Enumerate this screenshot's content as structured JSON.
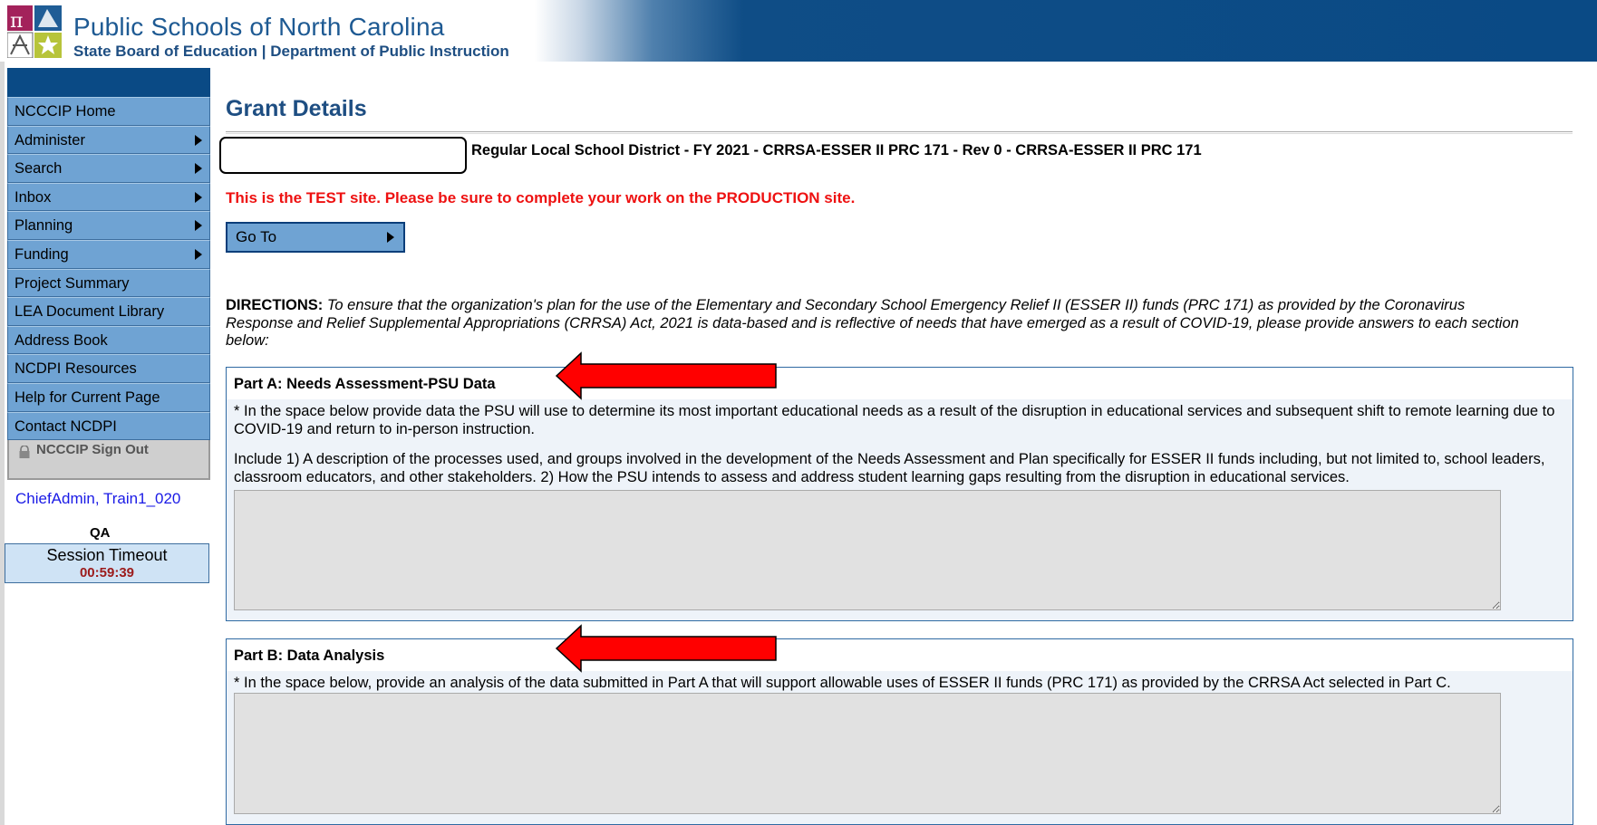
{
  "header": {
    "title": "Public Schools of North Carolina",
    "subtitle": "State Board of Education | Department of Public Instruction"
  },
  "sidebar": {
    "items": [
      {
        "label": "NCCCIP Home",
        "has_submenu": false
      },
      {
        "label": "Administer",
        "has_submenu": true
      },
      {
        "label": "Search",
        "has_submenu": true
      },
      {
        "label": "Inbox",
        "has_submenu": true
      },
      {
        "label": "Planning",
        "has_submenu": true
      },
      {
        "label": "Funding",
        "has_submenu": true
      },
      {
        "label": "Project Summary",
        "has_submenu": false
      },
      {
        "label": "LEA Document Library",
        "has_submenu": false
      },
      {
        "label": "Address Book",
        "has_submenu": false
      },
      {
        "label": "NCDPI Resources",
        "has_submenu": false
      },
      {
        "label": "Help for Current Page",
        "has_submenu": false
      },
      {
        "label": "Contact NCDPI",
        "has_submenu": false
      }
    ],
    "signout_label": "NCCCIP Sign Out",
    "user": "ChiefAdmin, Train1_020",
    "environment": "QA",
    "session": {
      "label": "Session Timeout",
      "time": "00:59:39"
    }
  },
  "main": {
    "page_title": "Grant Details",
    "grant_header": "Regular Local School District - FY 2021 - CRRSA-ESSER II PRC 171 - Rev 0 - CRRSA-ESSER II PRC 171",
    "test_warning": "This is the TEST site. Please be sure to complete your work on the PRODUCTION site.",
    "goto_label": "Go To",
    "directions_label": "DIRECTIONS:",
    "directions_text": "To ensure that the organization's plan for the use of the Elementary and Secondary School Emergency Relief II (ESSER II) funds (PRC 171) as provided by the Coronavirus Response and Relief Supplemental Appropriations (CRRSA) Act, 2021 is data-based and is reflective of needs that have emerged as a result of COVID-19, please provide answers to each section below:",
    "part_a": {
      "title": "Part A: Needs Assessment-PSU Data",
      "text1": "* In the space below provide data the PSU will use to determine its most important educational needs as a result of the disruption in educational services and subsequent shift to remote learning due to COVID-19 and return to in-person instruction.",
      "text2": "Include 1) A description of the processes used, and groups involved in the development of the Needs Assessment and Plan specifically for ESSER II funds including, but not limited to, school leaders, classroom educators, and other stakeholders. 2) How the PSU intends to assess and address student learning gaps resulting from the disruption in educational services.",
      "value": ""
    },
    "part_b": {
      "title": "Part B: Data Analysis",
      "text1": "* In the space below, provide an analysis of the data submitted in Part A that will support allowable uses of ESSER II funds (PRC 171) as provided by the CRRSA Act selected in Part C.",
      "value": ""
    }
  },
  "colors": {
    "header_blue": "#0a4a85",
    "menu_blue": "#6fa3d3",
    "warning_red": "#ee1111",
    "title_blue": "#1e4e82",
    "annotation_arrow": "#ff0000"
  }
}
